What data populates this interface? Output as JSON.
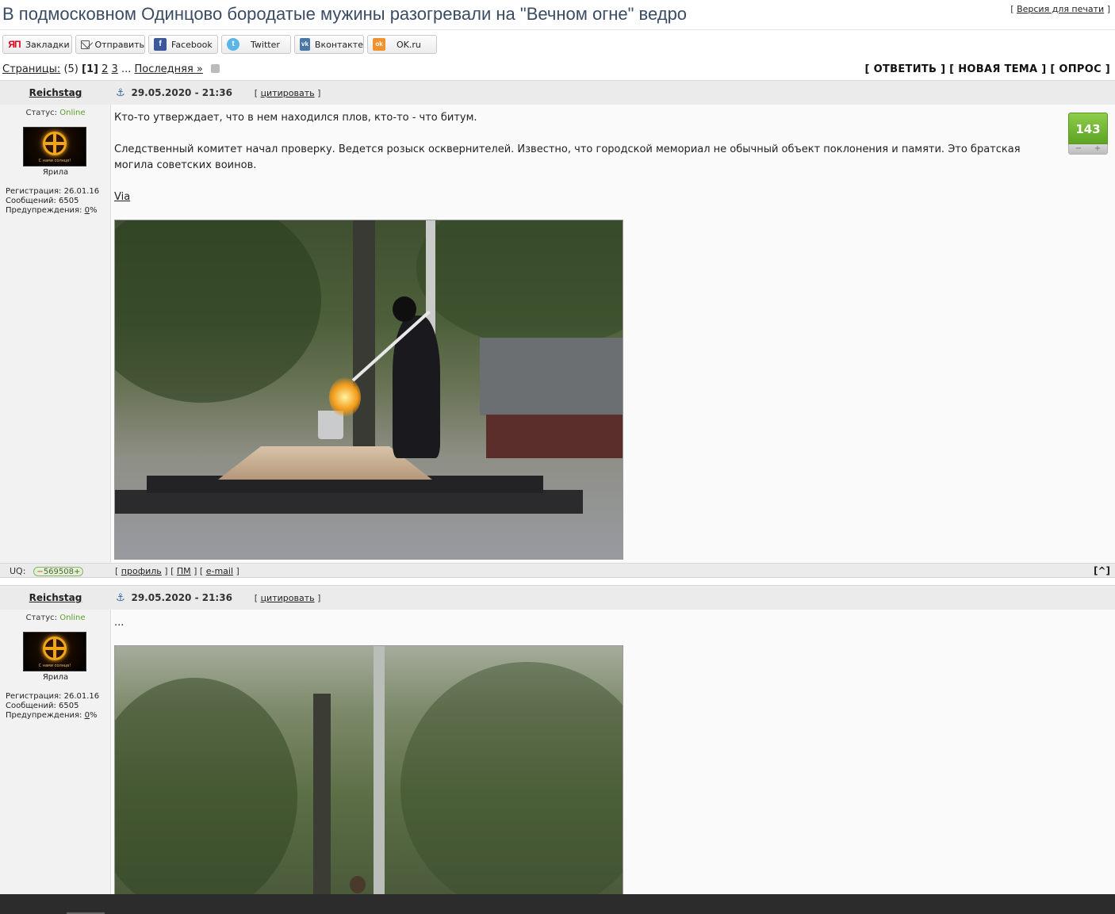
{
  "topic": {
    "title": "В подмосковном Одинцово бородатые мужины разогревали на \"Вечном огне\" ведро",
    "print_bracket_open": "[ ",
    "print_link": "Версия для печати",
    "print_bracket_close": " ]"
  },
  "share": {
    "bookmarks": "Закладки",
    "send": "Отправить",
    "facebook": "Facebook",
    "twitter": "Twitter",
    "vkontakte": "Вконтакте",
    "ok": "OK.ru",
    "icons": [
      "yandex-bookmarks-icon",
      "mail-icon",
      "facebook-icon",
      "twitter-icon",
      "vk-icon",
      "ok-icon"
    ],
    "ya_glyph": "ЯП",
    "fb_glyph": "f",
    "tw_glyph": "t",
    "vk_glyph": "vk",
    "ok_glyph": "ok"
  },
  "pagination": {
    "label": "Страницы:",
    "count": "(5)",
    "current": "[1]",
    "page2": "2",
    "page3": "3",
    "ellipsis": "...",
    "last": "Последняя »"
  },
  "actions": {
    "reply": "[ ОТВЕТИТЬ ]",
    "new_topic": "[ НОВАЯ ТЕМА ]",
    "poll": "[ ОПРОС ]"
  },
  "posts": [
    {
      "author": "Reichstag",
      "date": "29.05.2020 - 21:36",
      "quote_open": "[ ",
      "quote": "цитировать",
      "quote_close": " ]",
      "status_label": "Статус:",
      "status_value": "Online",
      "avatar_motto": "С нами солнце!",
      "user_title": "Ярила",
      "reg": "Регистрация: 26.01.16",
      "messages": "Сообщений: 6505",
      "warn_label": "Предупреждения: ",
      "warn_value": "0",
      "warn_pct": "%",
      "text1": "Кто-то утверждает, что в нем находился плов, кто-то - что битум.",
      "text2": "Следственный комитет начал проверку. Ведется розыск осквернителей. Известно, что городской мемориал не обычный объект поклонения и памяти. Это братская могила советских воинов.",
      "via": "Via",
      "rating": "143",
      "rating_minus": "−",
      "rating_plus": "+",
      "uq_label": "UQ:",
      "uq_minus": "−",
      "uq_value": "569508",
      "uq_plus": "+",
      "foot_open": "[ ",
      "profile": "профиль",
      "sep1": " ] [ ",
      "pm": "ПМ",
      "sep2": " ] [ ",
      "email": "e-mail",
      "foot_close": " ]",
      "to_top": "[^]"
    },
    {
      "author": "Reichstag",
      "date": "29.05.2020 - 21:36",
      "quote_open": "[ ",
      "quote": "цитировать",
      "quote_close": " ]",
      "status_label": "Статус:",
      "status_value": "Online",
      "avatar_motto": "С нами солнце!",
      "user_title": "Ярила",
      "reg": "Регистрация: 26.01.16",
      "messages": "Сообщений: 6505",
      "warn_label": "Предупреждения: ",
      "warn_value": "0",
      "warn_pct": "%",
      "text1": "..."
    }
  ],
  "post_icon": "anchor-icon",
  "anchor_glyph": "⚓"
}
